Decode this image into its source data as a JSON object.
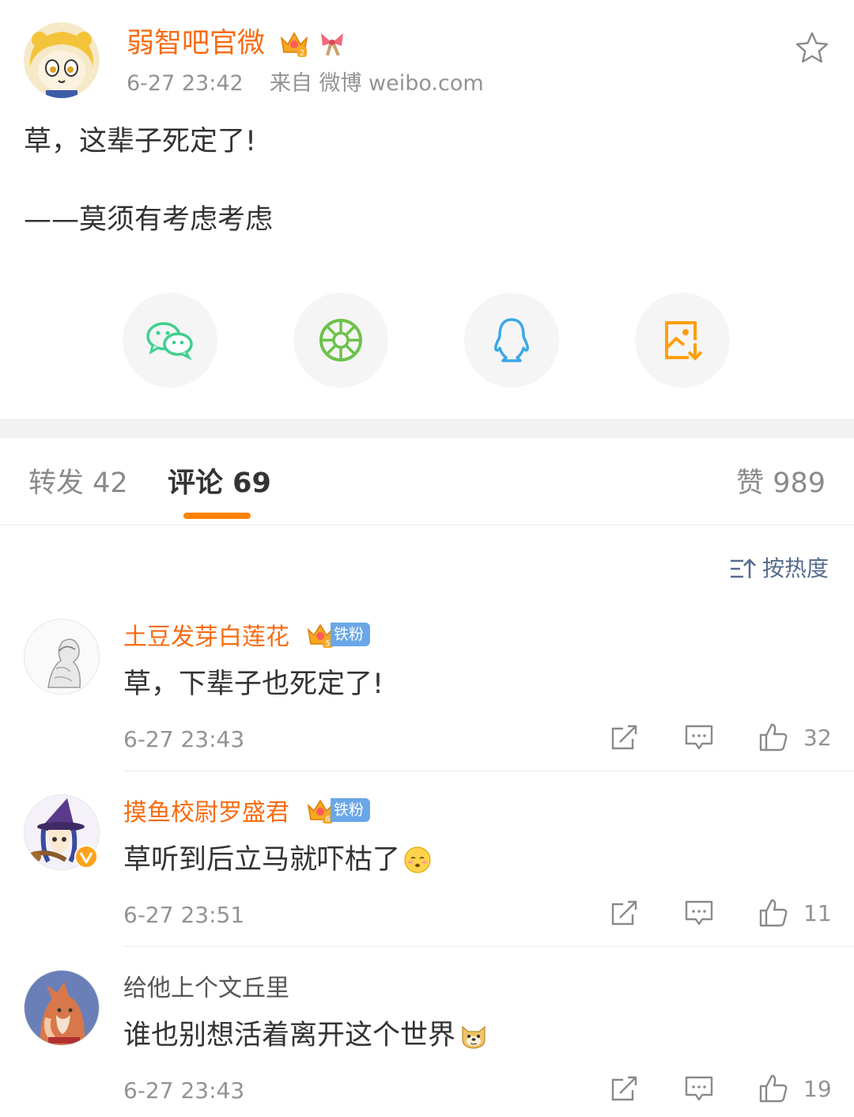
{
  "post": {
    "author": "弱智吧官微",
    "time": "6-27 23:42",
    "source": "来自 微博 weibo.com",
    "text": "草，这辈子死定了!",
    "sign": "——莫须有考虑考虑",
    "share_icons": [
      "wechat-icon",
      "moments-icon",
      "qq-icon",
      "save-image-icon"
    ]
  },
  "tabs": {
    "repost": "转发 42",
    "comment": "评论 69",
    "like": "赞 989"
  },
  "sort": {
    "label": "按热度",
    "icon": "sort-icon"
  },
  "comments": [
    {
      "name": "土豆发芽白莲花",
      "badge": "铁粉",
      "level": "5",
      "text": "草，下辈子也死定了!",
      "time": "6-27 23:43",
      "likes": "32"
    },
    {
      "name": "摸鱼校尉罗盛君",
      "badge": "铁粉",
      "level": "6",
      "text": "草听到后立马就吓枯了",
      "emoji": "awkward-emoji",
      "time": "6-27 23:51",
      "likes": "11"
    },
    {
      "name": "给他上个文丘里",
      "text": "谁也别想活着离开这个世界",
      "emoji": "doge-emoji",
      "time": "6-27 23:43",
      "likes": "19"
    }
  ],
  "colors": {
    "brand_orange": "#ff8200",
    "name_orange": "#f86b12",
    "link_blue": "#556c8e",
    "fan_blue": "#6aa7e8"
  }
}
